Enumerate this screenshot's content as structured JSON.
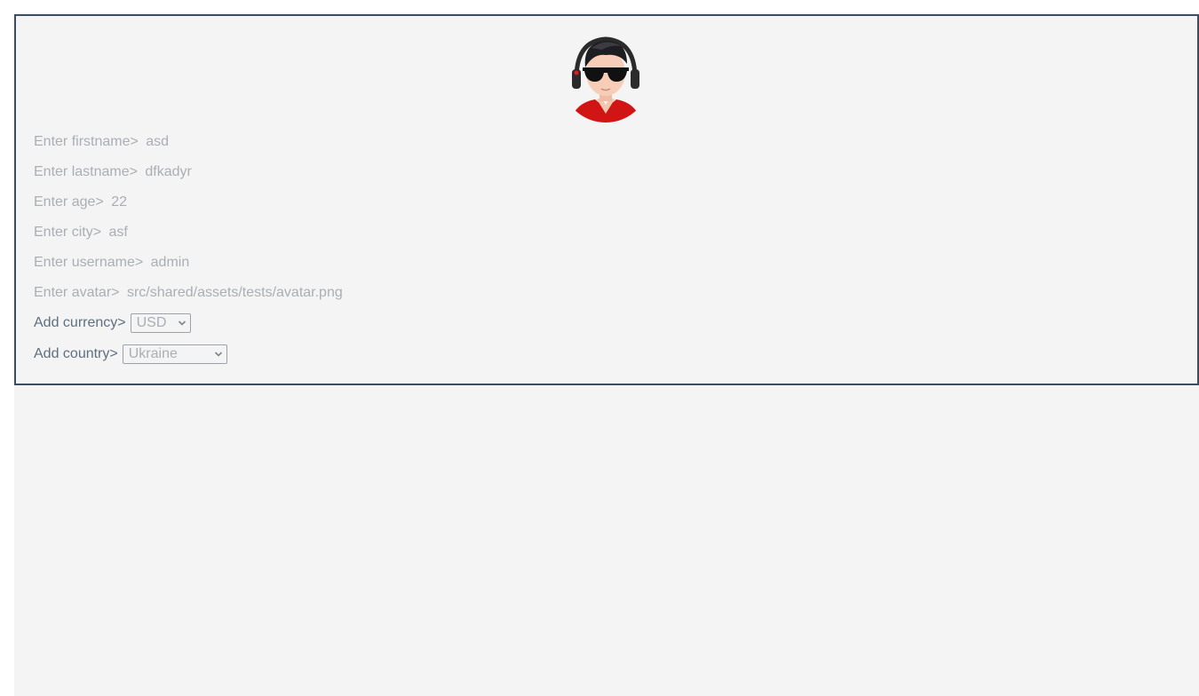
{
  "profile_card": {
    "fields": [
      {
        "label": "Enter firstname>",
        "value": "asd"
      },
      {
        "label": "Enter lastname>",
        "value": "dfkadyr"
      },
      {
        "label": "Enter age>",
        "value": "22"
      },
      {
        "label": "Enter city>",
        "value": "asf"
      },
      {
        "label": "Enter username>",
        "value": "admin"
      },
      {
        "label": "Enter avatar>",
        "value": "src/shared/assets/tests/avatar.png"
      }
    ],
    "currency": {
      "label": "Add currency>",
      "selected": "USD"
    },
    "country": {
      "label": "Add country>",
      "selected": "Ukraine"
    }
  },
  "colors": {
    "border": "#3d4d5c",
    "background": "#f4f4f4",
    "muted_text": "#a9afb5",
    "label_text": "#5e6f80"
  },
  "icons": {
    "avatar": "avatar-image",
    "select_arrow": "chevron-down-icon"
  }
}
